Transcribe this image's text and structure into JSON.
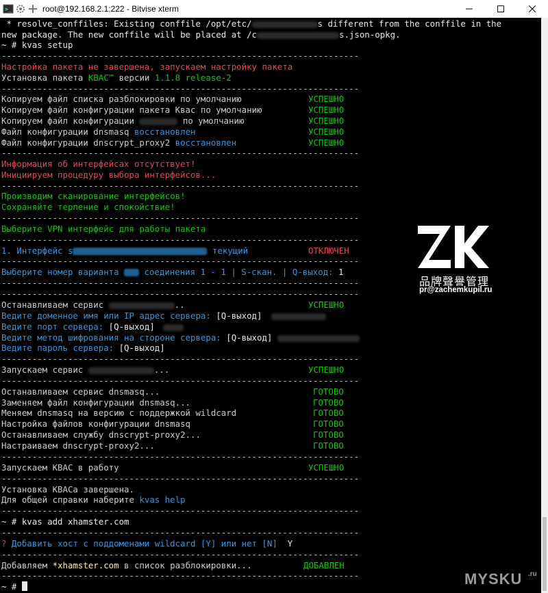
{
  "window": {
    "title": "root@192.168.2.1:222 - Bitvise xterm",
    "minimize_label": "—",
    "maximize_label": "☐",
    "close_label": "✕"
  },
  "terminal": {
    "l1": " * resolve_conffiles: Existing conffile /opt/etc/",
    "l1b": "s different from the conffile in the",
    "l2": "new package. The new conffile will be placed at /c",
    "l2b": "s.json-opkg.",
    "prompt1": "~ # kvas setup",
    "separator": "----------------------------------------------------------------------",
    "setup_incomplete": "Настройка пакета не завершена, запускаем настройку пакета",
    "install_a": "Установка пакета ",
    "install_kvas": "КВАС™",
    "install_b": " версии ",
    "install_ver": "1.1.8 release-2",
    "copy1": "Копируем файл списка разблокировки по умолчанию",
    "copy2": "Копируем файл конфигурации пакета Квас по умолчанию",
    "copy3a": "Копируем файл конфигурации ",
    "copy3b": " по умолчанию",
    "dnsmasq_cfg": "Файл конфигурации dnsmasq ",
    "dnscrypt_cfg": "Файл конфигурации dnscrypt_proxy2 ",
    "restored": "восстановлен",
    "success": "УСПЕШНО",
    "iface_missing": "Информация об интерфейсах отсутствует!",
    "iface_select_init": "Инициируем процедуру выбора интерфейсов...",
    "scan": "Производим сканирование интерфейсов!",
    "patience": "Сохраняйте терпение и спокойствие!",
    "choose_vpn": "Выберите VPN интерфейс для работы пакета",
    "iface1a": "1. Интерфейс s",
    "iface1b": " текущий",
    "disabled": "ОТКЛЮЧЕН",
    "choose_num_a": "Выберите номер варианта ",
    "choose_num_b": " соединения 1 - 1 | S-скан. | Q-выход: ",
    "choose_num_val": "1",
    "stop_service": "Останавливаем сервис ",
    "dots2": "..",
    "enter_domain": "Ведите доменное имя или IP адрес сервера: ",
    "q_exit": "[Q-выход]",
    "enter_port": "Ведите порт сервера: ",
    "enter_cipher": "Ведите метод шифрования на стороне сервера: ",
    "enter_pass": "Ведите пароль сервера: ",
    "start_service": "Запускаем сервис ",
    "dots3": "...",
    "stop_dnsmasq": "Останавливаем сервис dnsmasq...",
    "replace_dnsmasq": "Заменяем файл конфигурации dnsmasq...",
    "change_dnsmasq": "Меняем dnsmasq на версию с поддержкой wildcard",
    "setup_dnsmasq": "Настройка файлов конфигурации dnsmasq",
    "stop_dnscrypt": "Останавливаем службу dnscrypt-proxy2...",
    "setup_dnscrypt": "Настраиваем dnscrypt-proxy2...",
    "done": "ГОТОВО",
    "start_kvas": "Запускаем КВАС в работу",
    "kvas_done": "Установка КВАСа завершена.",
    "help_a": "Для общей справки наберите ",
    "help_cmd": "kvas help",
    "prompt2": "~ # kvas add xhamster.com",
    "question_mark": "?",
    "add_host": " Добавить хост с поддоменами wildcard [Y] или нет [N]",
    "answer_y": "  Y",
    "adding_a": "Добавляем ",
    "adding_host": "*xhamster.com",
    "adding_b": " в список разблокировки...",
    "added": "ДОБАВЛЕН",
    "prompt3": "~ # "
  },
  "watermark": {
    "logo_text": "ZK",
    "cn_text": "品牌聲譽管理",
    "email": "pr@zachemkupil.ru",
    "site": "MYSKU",
    "site_suffix": ".ru"
  },
  "colors": {
    "background": "#000000",
    "text": "#c0c0c0",
    "green": "#16c60c",
    "red": "#e74856",
    "blue": "#3a96dd",
    "yellow": "#f9f1a5"
  }
}
